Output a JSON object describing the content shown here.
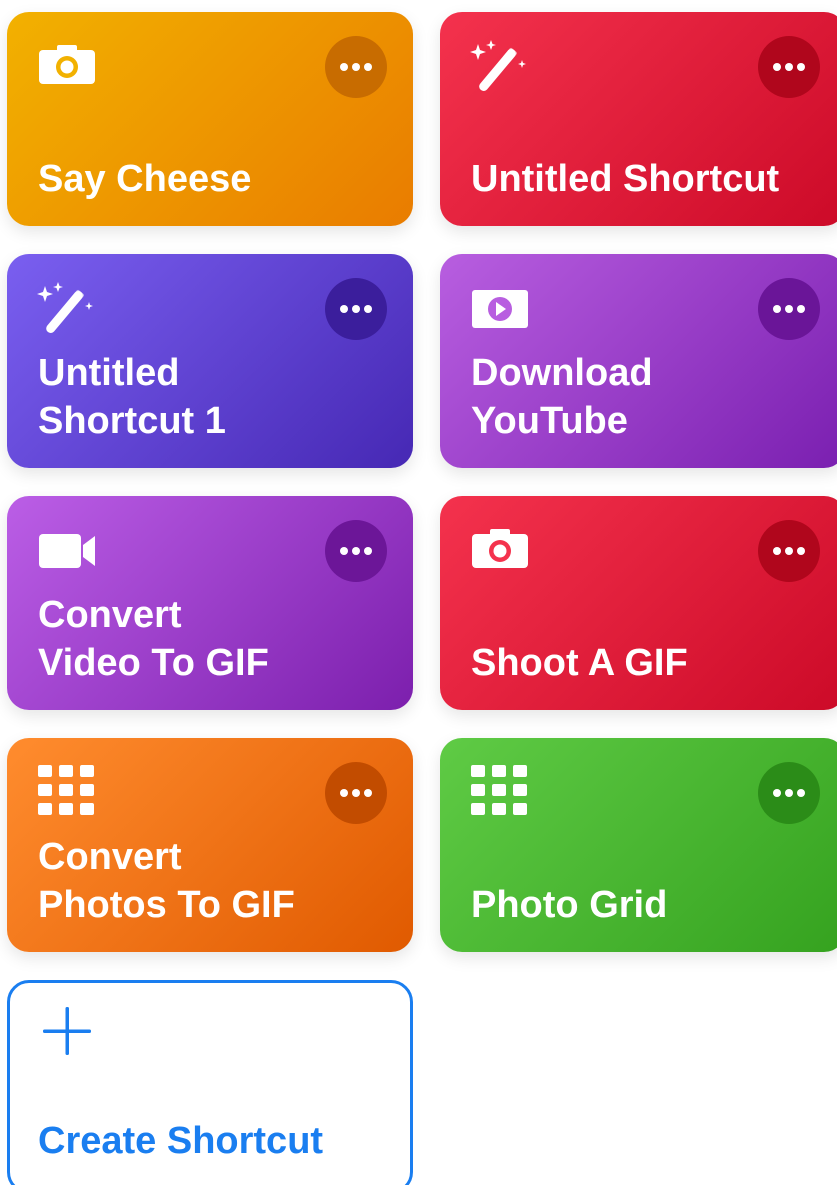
{
  "shortcuts": [
    {
      "id": "say-cheese",
      "title_lines": [
        "Say Cheese"
      ],
      "icon": "camera-icon",
      "gradient": [
        "#f2b100",
        "#e97c00"
      ],
      "more_bg": "#c86c00"
    },
    {
      "id": "untitled-shortcut",
      "title_lines": [
        "Untitled Shortcut"
      ],
      "icon": "magic-wand-icon",
      "gradient": [
        "#f4324d",
        "#cc0a28"
      ],
      "more_bg": "#b0061c"
    },
    {
      "id": "untitled-shortcut-1",
      "title_lines": [
        "Untitled",
        "Shortcut 1"
      ],
      "icon": "magic-wand-icon",
      "gradient": [
        "#7a5ff0",
        "#4628b4"
      ],
      "more_bg": "#3b1e9c"
    },
    {
      "id": "download-youtube",
      "title_lines": [
        "Download",
        "YouTube"
      ],
      "icon": "play-video-icon",
      "gradient": [
        "#b85ee0",
        "#7a1fb0"
      ],
      "more_bg": "#6a1598"
    },
    {
      "id": "convert-video-to-gif",
      "title_lines": [
        "Convert",
        "Video To GIF"
      ],
      "icon": "video-camera-icon",
      "gradient": [
        "#bb5ee6",
        "#7c1fad"
      ],
      "more_bg": "#6c1698"
    },
    {
      "id": "shoot-a-gif",
      "title_lines": [
        "Shoot A GIF"
      ],
      "icon": "camera-icon",
      "gradient": [
        "#f4324d",
        "#cc0a28"
      ],
      "more_bg": "#b0061c"
    },
    {
      "id": "convert-photos-to-gif",
      "title_lines": [
        "Convert",
        "Photos To GIF"
      ],
      "icon": "grid-icon",
      "gradient": [
        "#ff8c2e",
        "#e05a00"
      ],
      "more_bg": "#c24c00"
    },
    {
      "id": "photo-grid",
      "title_lines": [
        "Photo Grid"
      ],
      "icon": "grid-icon",
      "gradient": [
        "#5fcb45",
        "#35a21f"
      ],
      "more_bg": "#2b8c18"
    }
  ],
  "create_shortcut": {
    "label": "Create Shortcut",
    "icon": "plus-icon",
    "color": "#1a7ef0"
  }
}
